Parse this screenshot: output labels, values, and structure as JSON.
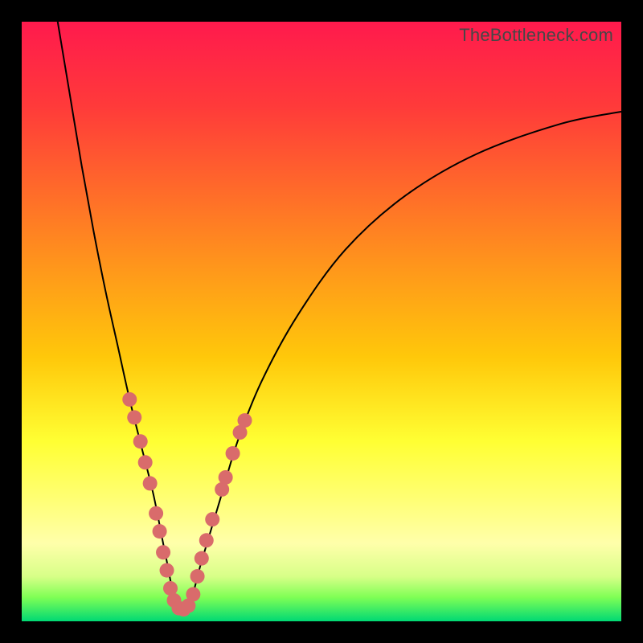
{
  "watermark": "TheBottleneck.com",
  "colors": {
    "frame": "#000000",
    "gradient_top": "#ff1a4d",
    "gradient_bottom": "#00d973",
    "curve": "#000000",
    "dots": "#d96b6b"
  },
  "chart_data": {
    "type": "line",
    "title": "",
    "xlabel": "",
    "ylabel": "",
    "xlim": [
      0,
      100
    ],
    "ylim": [
      0,
      100
    ],
    "notes": "V-shaped bottleneck curve on rainbow gradient (red=high mismatch, green=optimal). Minimum near x≈26. No numeric axis ticks shown in source image; values estimated by geometry.",
    "series": [
      {
        "name": "bottleneck-curve",
        "x": [
          6,
          8,
          10,
          12,
          14,
          16,
          18,
          20,
          22,
          24,
          26,
          28,
          30,
          33,
          36,
          40,
          46,
          54,
          64,
          76,
          90,
          100
        ],
        "y": [
          100,
          88,
          76,
          65,
          55,
          46,
          37,
          29,
          21,
          11,
          2,
          3,
          10,
          20,
          30,
          40,
          51,
          62,
          71,
          78,
          83,
          85
        ]
      }
    ],
    "markers": {
      "name": "highlighted-points",
      "note": "Salmon dots clustered near curve bottom on both arms.",
      "points": [
        {
          "x": 18.0,
          "y": 37.0
        },
        {
          "x": 18.8,
          "y": 34.0
        },
        {
          "x": 19.8,
          "y": 30.0
        },
        {
          "x": 20.6,
          "y": 26.5
        },
        {
          "x": 21.4,
          "y": 23.0
        },
        {
          "x": 22.4,
          "y": 18.0
        },
        {
          "x": 23.0,
          "y": 15.0
        },
        {
          "x": 23.6,
          "y": 11.5
        },
        {
          "x": 24.2,
          "y": 8.5
        },
        {
          "x": 24.8,
          "y": 5.5
        },
        {
          "x": 25.4,
          "y": 3.5
        },
        {
          "x": 26.2,
          "y": 2.2
        },
        {
          "x": 27.0,
          "y": 2.0
        },
        {
          "x": 27.8,
          "y": 2.6
        },
        {
          "x": 28.6,
          "y": 4.5
        },
        {
          "x": 29.3,
          "y": 7.5
        },
        {
          "x": 30.0,
          "y": 10.5
        },
        {
          "x": 30.8,
          "y": 13.5
        },
        {
          "x": 31.8,
          "y": 17.0
        },
        {
          "x": 33.4,
          "y": 22.0
        },
        {
          "x": 34.0,
          "y": 24.0
        },
        {
          "x": 35.2,
          "y": 28.0
        },
        {
          "x": 36.4,
          "y": 31.5
        },
        {
          "x": 37.2,
          "y": 33.5
        }
      ]
    }
  }
}
